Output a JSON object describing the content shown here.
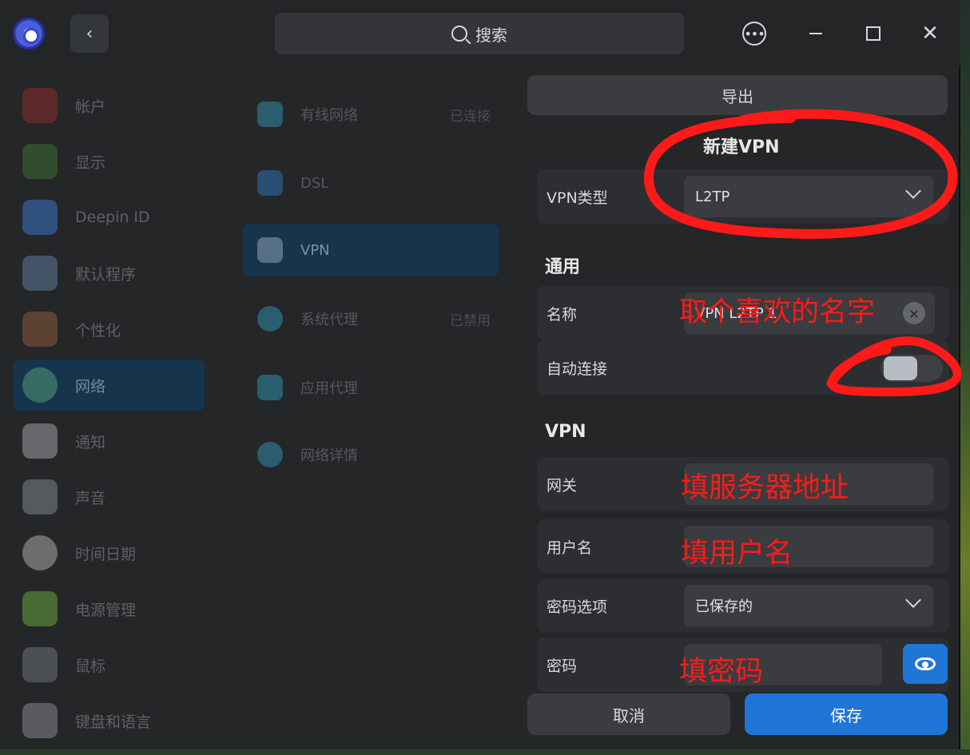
{
  "titlebar": {
    "search_placeholder": "搜索",
    "back_icon": "chevron-left-icon",
    "menu_icon": "more-icon",
    "minimize_icon": "minimize-icon",
    "maximize_icon": "maximize-icon",
    "close_icon": "close-icon"
  },
  "sidebar": {
    "items": [
      {
        "label": "帐户",
        "icon": "account-icon",
        "color": "#8a2c2c"
      },
      {
        "label": "显示",
        "icon": "display-icon",
        "color": "#3d6b33"
      },
      {
        "label": "Deepin ID",
        "icon": "cloud-icon",
        "color": "#3a74c2"
      },
      {
        "label": "默认程序",
        "icon": "default-apps-icon",
        "color": "#5d7a9b"
      },
      {
        "label": "个性化",
        "icon": "personalization-icon",
        "color": "#8a5a3d"
      },
      {
        "label": "网络",
        "icon": "network-icon",
        "color": "#4f9a78"
      },
      {
        "label": "通知",
        "icon": "notification-icon",
        "color": "#9c9ea2"
      },
      {
        "label": "声音",
        "icon": "sound-icon",
        "color": "#7f8388"
      },
      {
        "label": "时间日期",
        "icon": "clock-icon",
        "color": "#a5a7aa"
      },
      {
        "label": "电源管理",
        "icon": "power-icon",
        "color": "#67a33a"
      },
      {
        "label": "鼠标",
        "icon": "mouse-icon",
        "color": "#6e7176"
      },
      {
        "label": "键盘和语言",
        "icon": "keyboard-icon",
        "color": "#85878b"
      }
    ]
  },
  "network_list": {
    "items": [
      {
        "label": "有线网络",
        "status": "已连接",
        "icon": "wired-icon",
        "color": "#2f8aa8"
      },
      {
        "label": "DSL",
        "status": "",
        "icon": "dsl-icon",
        "color": "#2f6fb0"
      },
      {
        "label": "VPN",
        "status": "",
        "icon": "vpn-icon",
        "color": "#8ea3b8"
      },
      {
        "label": "系统代理",
        "status": "已禁用",
        "icon": "system-proxy-icon",
        "color": "#2f8aa8"
      },
      {
        "label": "应用代理",
        "status": "",
        "icon": "app-proxy-icon",
        "color": "#2f8aa8"
      },
      {
        "label": "网络详情",
        "status": "",
        "icon": "info-icon",
        "color": "#2f8aa8"
      }
    ]
  },
  "form": {
    "export_label": "导出",
    "title": "新建VPN",
    "vpn_type_label": "VPN类型",
    "vpn_type_value": "L2TP",
    "general_section": "通用",
    "name_label": "名称",
    "name_value": "VPN L2TP 1",
    "auto_connect_label": "自动连接",
    "auto_connect_on": false,
    "vpn_section": "VPN",
    "gateway_label": "网关",
    "gateway_value": "",
    "username_label": "用户名",
    "username_value": "",
    "password_option_label": "密码选项",
    "password_option_value": "已保存的",
    "password_label": "密码",
    "password_value": "",
    "cancel_label": "取消",
    "save_label": "保存",
    "accent_color": "#1f76d8"
  },
  "annotations": {
    "name_hint": "取个喜欢的名字",
    "gateway_hint": "填服务器地址",
    "username_hint": "填用户名",
    "password_hint": "填密码",
    "color": "#ff1a1a"
  }
}
